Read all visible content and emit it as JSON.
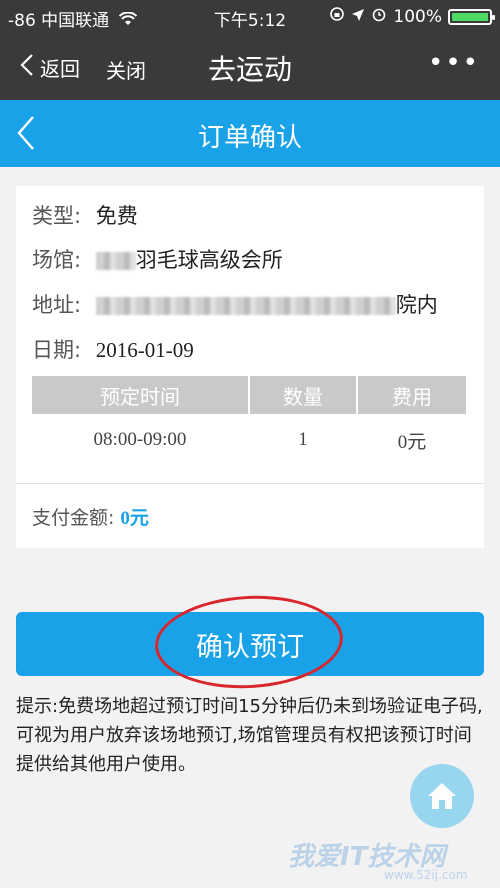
{
  "status_bar": {
    "carrier": "-86 中国联通",
    "time": "下午5:12",
    "battery": "100%"
  },
  "wechat_nav": {
    "back_label": "返回",
    "close_label": "关闭",
    "title": "去运动",
    "more": "•••"
  },
  "header": {
    "title": "订单确认"
  },
  "order": {
    "type_label": "类型:",
    "type_value": "免费",
    "venue_label": "场馆:",
    "venue_value": "羽毛球高级会所",
    "address_label": "地址:",
    "address_value": "院内",
    "date_label": "日期:",
    "date_value": "2016-01-09",
    "table": {
      "headers": [
        "预定时间",
        "数量",
        "费用"
      ],
      "rows": [
        [
          "08:00-09:00",
          "1",
          "0元"
        ]
      ]
    },
    "pay_label": "支付金额:",
    "pay_amount": "0元"
  },
  "confirm_label": "确认预订",
  "hint": "提示:免费场地超过预订时间15分钟后仍未到场验证电子码,可视为用户放弃该场地预订,场馆管理员有权把该预订时间提供给其他用户使用。",
  "watermark": {
    "main": "我爱IT技术网",
    "sub": "www.52ij.com"
  },
  "colors": {
    "accent": "#1aa2e8",
    "nav_bg": "#3a3a3a",
    "highlight_ring": "#d8262c"
  }
}
